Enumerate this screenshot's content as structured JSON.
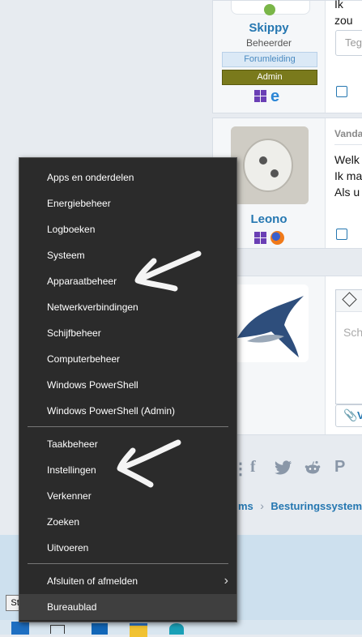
{
  "forum": {
    "post1": {
      "username": "Skippy",
      "role": "Beheerder",
      "badge1": "Forumleiding",
      "badge2": "Admin",
      "text": "Ik zou",
      "reply_placeholder": "Teg"
    },
    "post2": {
      "username": "Leono",
      "meta": "Vanda",
      "lines": [
        "Welk",
        "Ik ma",
        "Als u"
      ]
    },
    "editor": {
      "placeholder": "Sch"
    },
    "attach": "V",
    "breadcrumb": {
      "prev": "ms",
      "sep": "›",
      "current": "Besturingssystemen"
    }
  },
  "menu": {
    "group1": [
      "Apps en onderdelen",
      "Energiebeheer",
      "Logboeken",
      "Systeem",
      "Apparaatbeheer",
      "Netwerkverbindingen",
      "Schijfbeheer",
      "Computerbeheer",
      "Windows PowerShell",
      "Windows PowerShell (Admin)"
    ],
    "group2": [
      "Taakbeheer",
      "Instellingen",
      "Verkenner",
      "Zoeken",
      "Uitvoeren"
    ],
    "group3": {
      "shutdown": "Afsluiten of afmelden",
      "desktop": "Bureaublad"
    }
  },
  "tooltip": "Start",
  "colors": {
    "menu_bg": "#2b2b2b",
    "accent": "#2577b1",
    "admin_badge": "#7a7a1c"
  }
}
